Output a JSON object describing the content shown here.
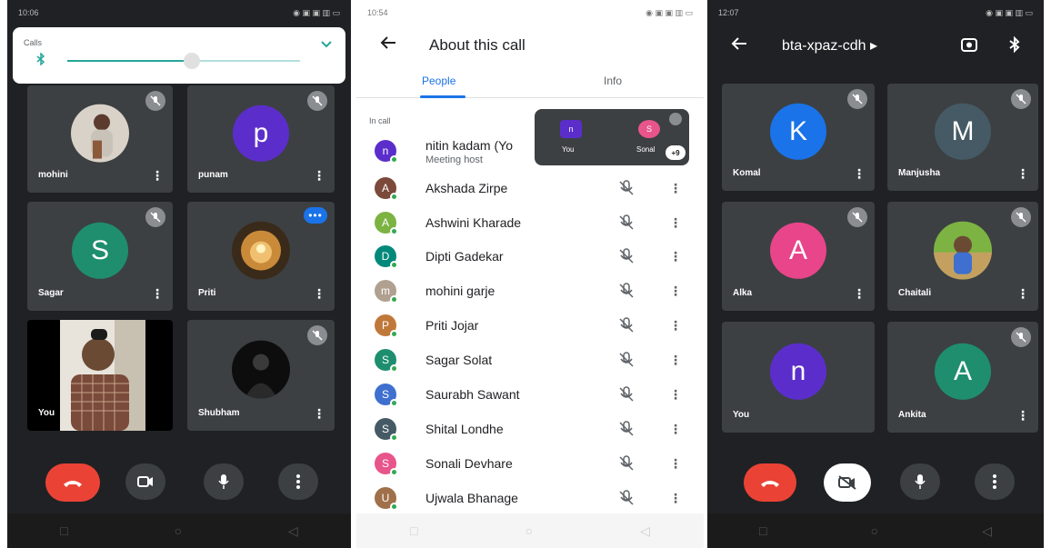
{
  "panel1": {
    "status_time": "10:06",
    "volume": {
      "label": "Calls",
      "icon": "bluetooth-icon"
    },
    "tiles": [
      {
        "name": "mohini",
        "avatar_type": "photo",
        "muted": true
      },
      {
        "name": "punam",
        "initial": "p",
        "color": "#5b2ecb",
        "muted": true
      },
      {
        "name": "Sagar",
        "initial": "S",
        "color": "#1e8e6f",
        "muted": true
      },
      {
        "name": "Priti",
        "avatar_type": "photo",
        "speaking": true
      },
      {
        "name": "You",
        "avatar_type": "video"
      },
      {
        "name": "Shubham",
        "avatar_type": "photo",
        "muted": true
      }
    ]
  },
  "panel2": {
    "status_time": "10:54",
    "title": "About this call",
    "tabs": [
      {
        "label": "People"
      },
      {
        "label": "Info"
      }
    ],
    "section_label": "In call",
    "pip": {
      "you_label": "You",
      "you_initial": "n",
      "other_label": "Sonal",
      "other_initial": "S",
      "badge": "+9"
    },
    "people": [
      {
        "name": "nitin kadam (Yo",
        "subtitle": "Meeting host",
        "initial": "n",
        "color": "#5b2ecb"
      },
      {
        "name": "Akshada Zirpe",
        "initial": "A",
        "color": "#7b4a3a"
      },
      {
        "name": "Ashwini Kharade",
        "initial": "A",
        "color": "#7cb342"
      },
      {
        "name": "Dipti Gadekar",
        "initial": "D",
        "color": "#00897b"
      },
      {
        "name": "mohini garje",
        "initial": "m",
        "color": "#b0a090"
      },
      {
        "name": "Priti Jojar",
        "initial": "P",
        "color": "#c0783a"
      },
      {
        "name": "Sagar Solat",
        "initial": "S",
        "color": "#1e8e6f"
      },
      {
        "name": "Saurabh Sawant",
        "initial": "S",
        "color": "#3f6fcf"
      },
      {
        "name": "Shital Londhe",
        "initial": "S",
        "color": "#455a64"
      },
      {
        "name": "Sonali Devhare",
        "initial": "S",
        "color": "#e8558a"
      },
      {
        "name": "Ujwala Bhanage",
        "initial": "U",
        "color": "#a0704a"
      }
    ]
  },
  "panel3": {
    "status_time": "12:07",
    "meeting_code": "bta-xpaz-cdh ▸",
    "tiles": [
      {
        "name": "Komal",
        "initial": "K",
        "color": "#1a73e8",
        "muted": true
      },
      {
        "name": "Manjusha",
        "initial": "M",
        "color": "#455a64",
        "muted": true
      },
      {
        "name": "Alka",
        "initial": "A",
        "color": "#e8458a",
        "muted": true
      },
      {
        "name": "Chaitali",
        "avatar_type": "photo",
        "muted": true
      },
      {
        "name": "You",
        "initial": "n",
        "color": "#5b2ecb"
      },
      {
        "name": "Ankita",
        "initial": "A",
        "color": "#1e8e6f",
        "muted": true
      }
    ]
  }
}
